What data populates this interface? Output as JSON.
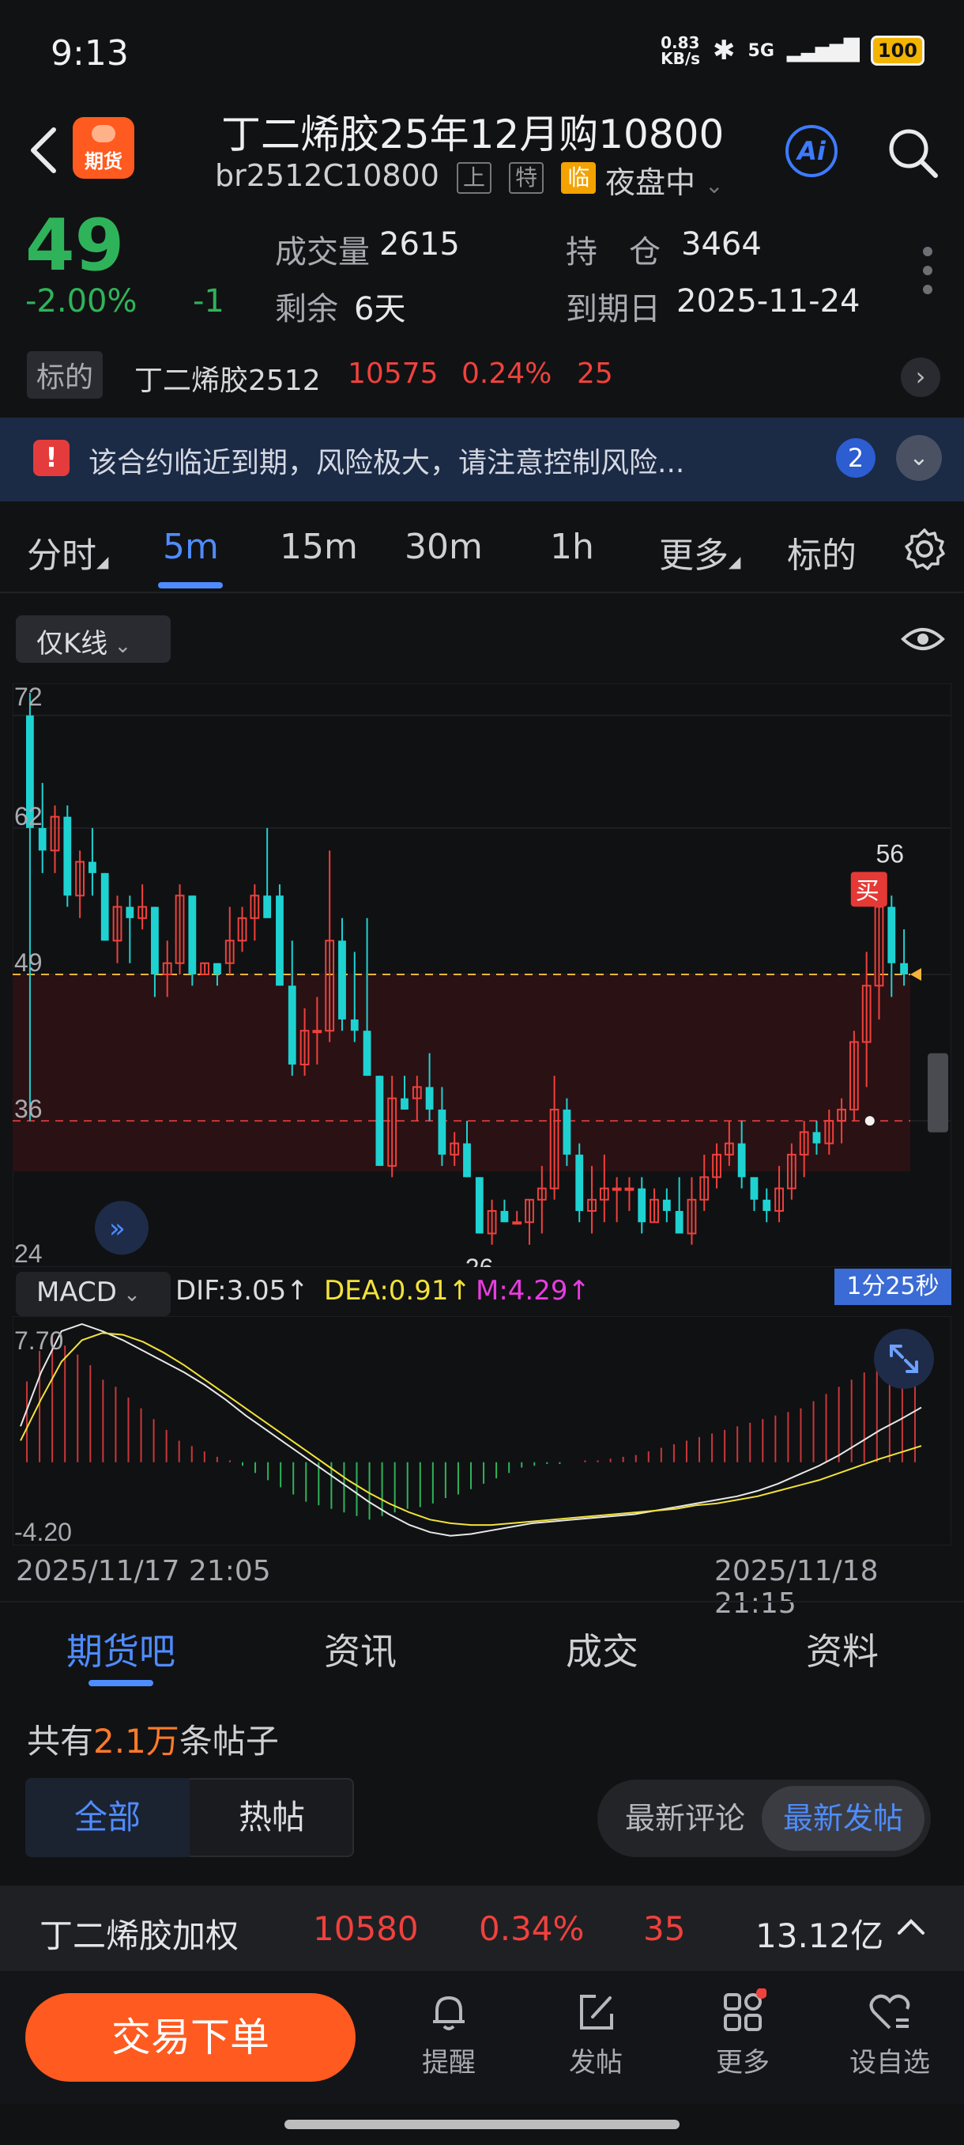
{
  "status_bar": {
    "time": "9:13",
    "net_speed": "0.83\nKB/s",
    "signal": "5G",
    "battery": "100"
  },
  "header": {
    "title": "丁二烯胶25年12月购10800",
    "code": "br2512C10800",
    "tags": [
      "上",
      "特",
      "临"
    ],
    "session": "夜盘中",
    "logo_text": "期货",
    "ai_label": "Ai"
  },
  "quote": {
    "price": "49",
    "change_pct": "-2.00%",
    "change": "-1",
    "volume_label": "成交量",
    "volume": "2615",
    "oi_label": "持　仓",
    "oi": "3464",
    "remaining_label": "剩余",
    "remaining": "6天",
    "expiry_label": "到期日",
    "expiry": "2025-11-24"
  },
  "underlying": {
    "tag": "标的",
    "name": "丁二烯胶2512",
    "price": "10575",
    "pct": "0.24%",
    "change": "25"
  },
  "risk_banner": {
    "text": "该合约临近到期，风险极大，请注意控制风险...",
    "count": "2"
  },
  "period_tabs": [
    "分时",
    "5m",
    "15m",
    "30m",
    "1h",
    "更多",
    "标的"
  ],
  "active_period": "5m",
  "chart_toolbar": {
    "kline_mode": "仅K线"
  },
  "chart_data": {
    "type": "candlestick",
    "y_ticks": [
      "72",
      "62",
      "49",
      "36",
      "24"
    ],
    "ylim": [
      24,
      74
    ],
    "current_price_line": 49,
    "reference_line": 36,
    "high_label": "56",
    "low_label": "26",
    "signal_label": "买",
    "candles": [
      [
        72,
        74,
        36,
        62
      ],
      [
        62,
        66,
        58,
        60
      ],
      [
        60,
        64,
        58,
        63
      ],
      [
        63,
        64,
        55,
        56
      ],
      [
        56,
        60,
        54,
        59
      ],
      [
        59,
        62,
        56,
        58
      ],
      [
        58,
        58,
        52,
        52
      ],
      [
        52,
        56,
        50,
        55
      ],
      [
        55,
        56,
        50,
        54
      ],
      [
        54,
        57,
        53,
        55
      ],
      [
        55,
        55,
        47,
        49
      ],
      [
        49,
        52,
        47,
        50
      ],
      [
        50,
        57,
        49,
        56
      ],
      [
        56,
        56,
        48,
        49
      ],
      [
        49,
        50,
        49,
        50
      ],
      [
        50,
        50,
        48,
        49
      ],
      [
        50,
        55,
        49,
        52
      ],
      [
        52,
        55,
        51,
        54
      ],
      [
        54,
        57,
        52,
        56
      ],
      [
        56,
        62,
        54,
        54
      ],
      [
        56,
        57,
        48,
        48
      ],
      [
        48,
        52,
        40,
        41
      ],
      [
        41,
        46,
        40,
        44
      ],
      [
        44,
        47,
        41,
        44
      ],
      [
        44,
        60,
        43,
        52
      ],
      [
        52,
        54,
        44,
        45
      ],
      [
        45,
        51,
        43,
        44
      ],
      [
        44,
        54,
        40,
        40
      ],
      [
        40,
        40,
        32,
        32
      ],
      [
        32,
        40,
        31,
        38
      ],
      [
        38,
        40,
        37,
        37
      ],
      [
        38,
        40,
        36,
        39
      ],
      [
        39,
        42,
        36,
        37
      ],
      [
        37,
        39,
        32,
        33
      ],
      [
        33,
        35,
        32,
        34
      ],
      [
        34,
        36,
        31,
        31
      ],
      [
        31,
        31,
        26,
        26
      ],
      [
        26,
        29,
        25,
        28
      ],
      [
        28,
        29,
        27,
        27
      ],
      [
        27,
        28,
        27,
        27
      ],
      [
        27,
        29,
        25,
        29
      ],
      [
        29,
        32,
        26,
        30
      ],
      [
        30,
        40,
        29,
        37
      ],
      [
        37,
        38,
        32,
        33
      ],
      [
        33,
        34,
        27,
        28
      ],
      [
        28,
        32,
        26,
        29
      ],
      [
        29,
        33,
        27,
        30
      ],
      [
        30,
        31,
        27,
        30
      ],
      [
        30,
        31,
        28,
        30
      ],
      [
        30,
        31,
        26,
        27
      ],
      [
        27,
        30,
        27,
        29
      ],
      [
        29,
        30,
        27,
        28
      ],
      [
        28,
        31,
        26,
        26
      ],
      [
        26,
        31,
        25,
        29
      ],
      [
        29,
        33,
        28,
        31
      ],
      [
        31,
        34,
        30,
        33
      ],
      [
        33,
        36,
        32,
        34
      ],
      [
        34,
        36,
        30,
        31
      ],
      [
        31,
        30,
        28,
        29
      ],
      [
        29,
        30,
        27,
        28
      ],
      [
        28,
        32,
        27,
        30
      ],
      [
        30,
        34,
        29,
        33
      ],
      [
        33,
        36,
        31,
        35
      ],
      [
        35,
        36,
        33,
        34
      ],
      [
        34,
        37,
        33,
        36
      ],
      [
        36,
        38,
        34,
        37
      ],
      [
        37,
        44,
        36,
        43
      ],
      [
        43,
        51,
        39,
        48
      ],
      [
        48,
        56,
        45,
        55
      ],
      [
        55,
        56,
        47,
        50
      ],
      [
        50,
        53,
        48,
        49
      ]
    ],
    "macd": {
      "label": "MACD",
      "dif": "DIF:3.05↑",
      "dea": "DEA:0.91↑",
      "m": "M:4.29↑",
      "ylim_labels": [
        "7.70",
        "-4.20"
      ],
      "ylim": [
        -4.2,
        7.7
      ],
      "hist": [
        4.5,
        6.2,
        7.0,
        6.5,
        6.0,
        5.4,
        4.6,
        4.2,
        3.6,
        3.0,
        2.4,
        1.8,
        1.2,
        0.9,
        0.6,
        0.3,
        0.1,
        -0.2,
        -0.6,
        -1.0,
        -1.4,
        -1.8,
        -2.2,
        -2.4,
        -2.6,
        -2.8,
        -3.0,
        -3.2,
        -3.0,
        -2.8,
        -2.6,
        -2.5,
        -2.3,
        -2.0,
        -1.8,
        -1.5,
        -1.2,
        -0.9,
        -0.6,
        -0.3,
        -0.2,
        -0.1,
        -0.1,
        0.0,
        0.1,
        0.1,
        0.2,
        0.3,
        0.4,
        0.6,
        0.8,
        1.0,
        1.2,
        1.4,
        1.6,
        1.8,
        2.0,
        2.2,
        2.4,
        2.6,
        2.8,
        3.0,
        3.4,
        3.8,
        4.2,
        4.6,
        5.0,
        5.6,
        6.2,
        6.8,
        7.2
      ],
      "dif_line": [
        2.0,
        5.0,
        7.3,
        7.7,
        7.3,
        6.8,
        6.2,
        5.6,
        5.0,
        4.3,
        3.5,
        2.6,
        1.8,
        1.0,
        0.2,
        -0.6,
        -1.4,
        -2.2,
        -2.9,
        -3.5,
        -3.9,
        -4.1,
        -4.0,
        -3.8,
        -3.6,
        -3.4,
        -3.3,
        -3.2,
        -3.1,
        -3.0,
        -2.9,
        -2.7,
        -2.5,
        -2.3,
        -2.1,
        -1.9,
        -1.6,
        -1.2,
        -0.7,
        -0.2,
        0.4,
        1.1,
        1.8,
        2.4,
        3.05
      ],
      "dea_line": [
        1.2,
        3.5,
        5.6,
        6.8,
        7.2,
        7.1,
        6.7,
        6.1,
        5.4,
        4.6,
        3.8,
        3.0,
        2.2,
        1.4,
        0.6,
        -0.2,
        -1.0,
        -1.7,
        -2.3,
        -2.8,
        -3.2,
        -3.4,
        -3.5,
        -3.5,
        -3.4,
        -3.3,
        -3.2,
        -3.1,
        -3.0,
        -2.9,
        -2.8,
        -2.7,
        -2.6,
        -2.4,
        -2.3,
        -2.1,
        -1.9,
        -1.6,
        -1.3,
        -1.0,
        -0.6,
        -0.2,
        0.2,
        0.55,
        0.91
      ]
    },
    "date_start": "2025/11/17 21:05",
    "date_end": "2025/11/18 21:15",
    "timer": "1分25秒"
  },
  "bottom_tabs": [
    "期货吧",
    "资讯",
    "成交",
    "资料"
  ],
  "active_bottom_tab": "期货吧",
  "forum": {
    "count_prefix": "共有",
    "count_number": "2.1万",
    "count_suffix": "条帖子",
    "filter_all": "全部",
    "filter_hot": "热帖",
    "sort_comment": "最新评论",
    "sort_post": "最新发帖"
  },
  "index_bar": {
    "name": "丁二烯胶加权",
    "price": "10580",
    "pct": "0.34%",
    "change": "35",
    "amount": "13.12亿"
  },
  "bottom_nav": {
    "trade": "交易下单",
    "items": [
      {
        "label": "提醒",
        "icon": "bell-icon"
      },
      {
        "label": "发帖",
        "icon": "edit-icon"
      },
      {
        "label": "更多",
        "icon": "grid-icon"
      },
      {
        "label": "设自选",
        "icon": "heart-add-icon"
      }
    ]
  },
  "colors": {
    "up": "#f0413c",
    "down": "#1fd2d2",
    "accent": "#4f8cff",
    "brand": "#ff5a1f"
  }
}
